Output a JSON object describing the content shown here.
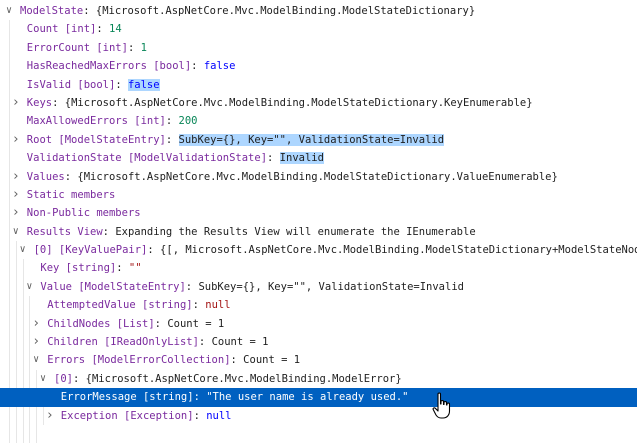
{
  "rows": [
    {
      "depth": 0,
      "toggle": "expanded",
      "name": "ModelState",
      "value": "{Microsoft.AspNetCore.Mvc.ModelBinding.ModelStateDictionary}",
      "vtype": "plain"
    },
    {
      "depth": 1,
      "toggle": "none",
      "name": "Count [int]",
      "value": "14",
      "vtype": "num"
    },
    {
      "depth": 1,
      "toggle": "none",
      "name": "ErrorCount [int]",
      "value": "1",
      "vtype": "num"
    },
    {
      "depth": 1,
      "toggle": "none",
      "name": "HasReachedMaxErrors [bool]",
      "value": "false",
      "vtype": "kw"
    },
    {
      "depth": 1,
      "toggle": "none",
      "name": "IsValid [bool]",
      "value": "false",
      "vtype": "kw",
      "highlight": true
    },
    {
      "depth": 1,
      "toggle": "collapsed",
      "name": "Keys",
      "value": "{Microsoft.AspNetCore.Mvc.ModelBinding.ModelStateDictionary.KeyEnumerable}",
      "vtype": "plain"
    },
    {
      "depth": 1,
      "toggle": "none",
      "name": "MaxAllowedErrors [int]",
      "value": "200",
      "vtype": "num"
    },
    {
      "depth": 1,
      "toggle": "collapsed",
      "name": "Root [ModelStateEntry]",
      "value": "SubKey={}, Key=\"\", ValidationState=Invalid",
      "vtype": "plain",
      "highlight": true
    },
    {
      "depth": 1,
      "toggle": "none",
      "name": "ValidationState [ModelValidationState]",
      "value": "Invalid",
      "vtype": "plain",
      "highlight": true
    },
    {
      "depth": 1,
      "toggle": "collapsed",
      "name": "Values",
      "value": "{Microsoft.AspNetCore.Mvc.ModelBinding.ModelStateDictionary.ValueEnumerable}",
      "vtype": "plain"
    },
    {
      "depth": 1,
      "toggle": "collapsed",
      "name": "Static members",
      "value": null,
      "vtype": "plain"
    },
    {
      "depth": 1,
      "toggle": "collapsed",
      "name": "Non-Public members",
      "value": null,
      "vtype": "plain"
    },
    {
      "depth": 1,
      "toggle": "expanded",
      "name": "Results View",
      "value": "Expanding the Results View will enumerate the IEnumerable",
      "vtype": "plain"
    },
    {
      "depth": 2,
      "toggle": "expanded",
      "name": "[0] [KeyValuePair]",
      "value": "{[, Microsoft.AspNetCore.Mvc.ModelBinding.ModelStateDictionary+ModelStateNode]}",
      "vtype": "plain"
    },
    {
      "depth": 3,
      "toggle": "none",
      "name": "Key [string]",
      "value": "\"\"",
      "vtype": "str"
    },
    {
      "depth": 3,
      "toggle": "expanded",
      "name": "Value [ModelStateEntry]",
      "value": "SubKey={}, Key=\"\", ValidationState=Invalid",
      "vtype": "plain"
    },
    {
      "depth": 4,
      "toggle": "none",
      "name": "AttemptedValue [string]",
      "value": "null",
      "vtype": "str"
    },
    {
      "depth": 4,
      "toggle": "collapsed",
      "name": "ChildNodes [List]",
      "value": "Count = 1",
      "vtype": "plain"
    },
    {
      "depth": 4,
      "toggle": "collapsed",
      "name": "Children [IReadOnlyList]",
      "value": "Count = 1",
      "vtype": "plain"
    },
    {
      "depth": 4,
      "toggle": "expanded",
      "name": "Errors [ModelErrorCollection]",
      "value": "Count = 1",
      "vtype": "plain"
    },
    {
      "depth": 5,
      "toggle": "expanded",
      "name": "[0]",
      "value": "{Microsoft.AspNetCore.Mvc.ModelBinding.ModelError}",
      "vtype": "plain"
    },
    {
      "depth": 6,
      "toggle": "none",
      "name": "ErrorMessage [string]",
      "value": "\"The user name is already used.\"",
      "vtype": "str",
      "selected": true
    },
    {
      "depth": 6,
      "toggle": "collapsed",
      "name": "Exception [Exception]",
      "value": "null",
      "vtype": "kw"
    },
    {
      "depth": 5,
      "toggle": "none",
      "name": "",
      "value": null,
      "vtype": "plain"
    }
  ]
}
